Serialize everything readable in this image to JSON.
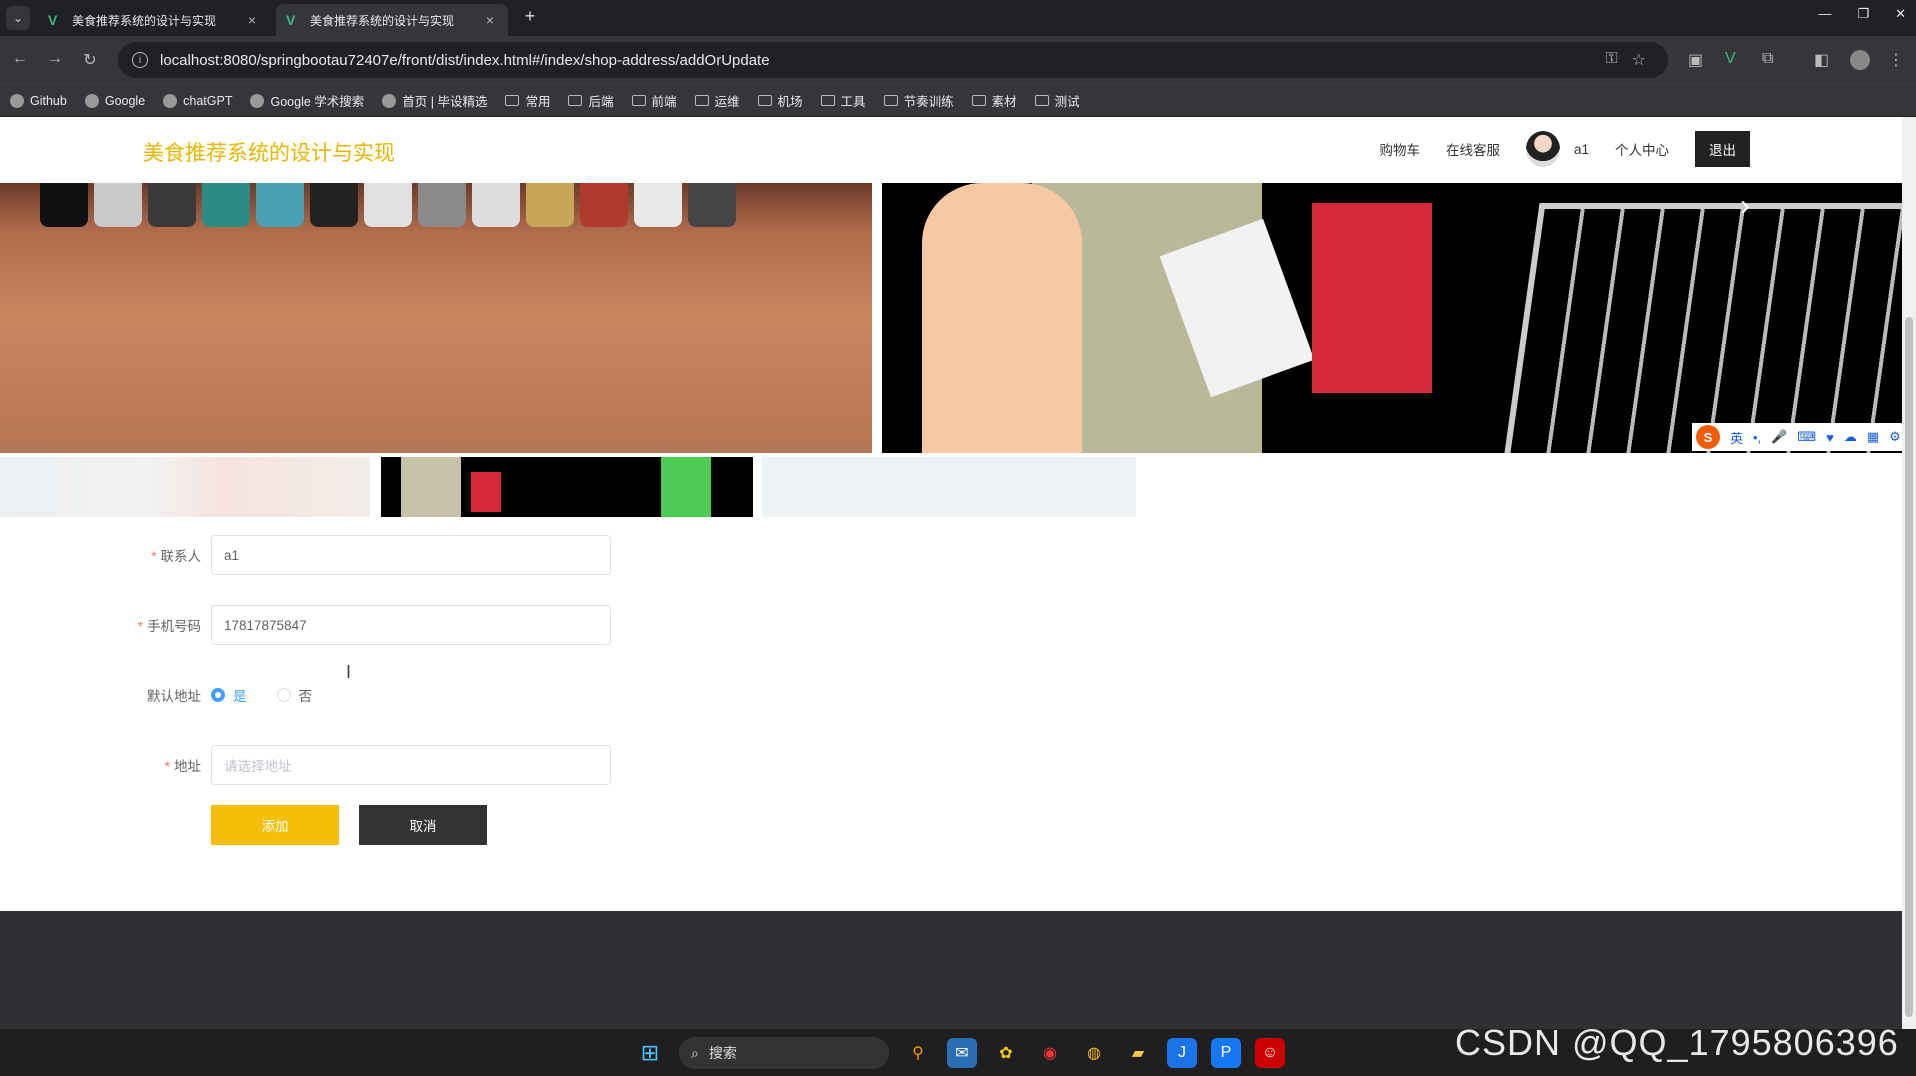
{
  "browser": {
    "tabs": [
      {
        "title": "美食推荐系统的设计与实现",
        "active": false
      },
      {
        "title": "美食推荐系统的设计与实现",
        "active": true
      }
    ],
    "url": "localhost:8080/springbootau72407e/front/dist/index.html#/index/shop-address/addOrUpdate",
    "bookmarks": [
      "Github",
      "Google",
      "chatGPT",
      "Google 学术搜索",
      "首页 | 毕设精选",
      "常用",
      "后端",
      "前端",
      "运维",
      "机场",
      "工具",
      "节奏训练",
      "素材",
      "测试"
    ]
  },
  "site": {
    "title": "美食推荐系统的设计与实现",
    "nav": {
      "cart": "购物车",
      "service": "在线客服",
      "username": "a1",
      "profile": "个人中心",
      "logout": "退出"
    }
  },
  "ime": {
    "logo": "S",
    "lang": "英"
  },
  "form": {
    "contact_label": "联系人",
    "contact_value": "a1",
    "phone_label": "手机号码",
    "phone_value": "17817875847",
    "default_label": "默认地址",
    "default_yes": "是",
    "default_no": "否",
    "default_selected": "是",
    "address_label": "地址",
    "address_placeholder": "请选择地址",
    "add_button": "添加",
    "cancel_button": "取消"
  },
  "taskbar": {
    "search_label": "搜索"
  },
  "watermark": "CSDN @QQ_1795806396"
}
